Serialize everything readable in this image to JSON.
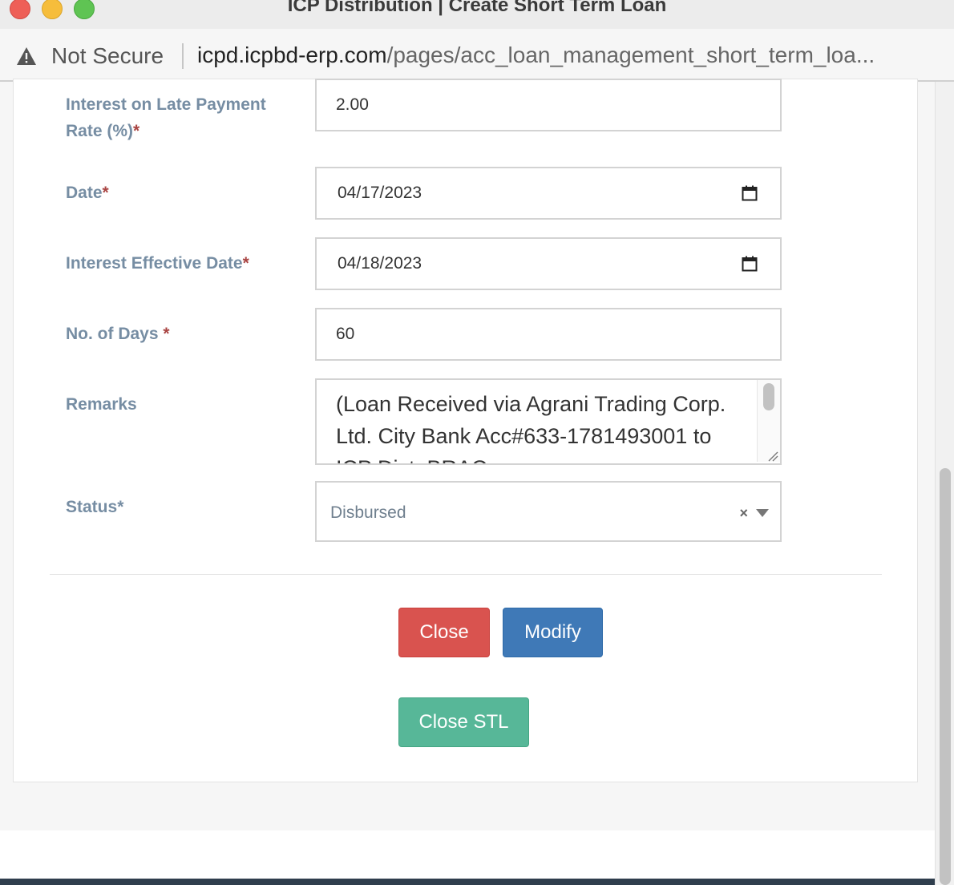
{
  "window": {
    "title": "ICP Distribution | Create Short Term Loan"
  },
  "address_bar": {
    "security_label": "Not Secure",
    "url_host": "icpd.icpbd-erp.com",
    "url_path": "/pages/acc_loan_management_short_term_loa..."
  },
  "form": {
    "late_payment_rate": {
      "label_line1": "Interest on Late Payment",
      "label_line2": "Rate (%)",
      "required_mark": "*",
      "value": "2.00"
    },
    "date": {
      "label": "Date",
      "required_mark": "*",
      "value": "04/17/2023"
    },
    "interest_effective_date": {
      "label": "Interest Effective Date",
      "required_mark": "*",
      "value": "04/18/2023"
    },
    "no_of_days": {
      "label": "No. of Days ",
      "required_mark": "*",
      "value": "60"
    },
    "remarks": {
      "label": "Remarks",
      "value": "(Loan Received via Agrani Trading Corp. Ltd. City Bank Acc#633-1781493001 to ICP Dist. BRAC"
    },
    "status": {
      "label": "Status",
      "required_mark": "*",
      "value": "Disbursed",
      "clear_symbol": "×"
    }
  },
  "buttons": {
    "close": "Close",
    "modify": "Modify",
    "close_stl": "Close STL"
  },
  "icons": {
    "security": "warning-triangle-icon",
    "calendar": "calendar-icon",
    "dropdown": "chevron-down-icon"
  },
  "colors": {
    "label": "#768da3",
    "required": "#a94442",
    "close_button": "#d9534f",
    "modify_button": "#3f79b7",
    "close_stl_button": "#57b798"
  }
}
